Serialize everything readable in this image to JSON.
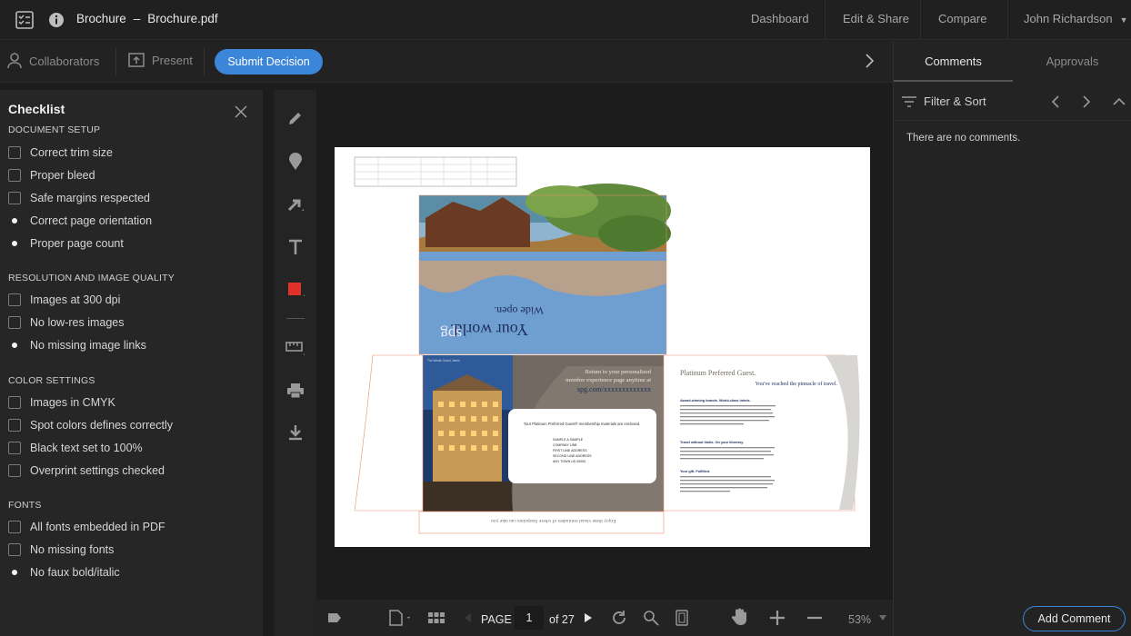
{
  "header": {
    "title": "Brochure",
    "separator": "–",
    "filename": "Brochure.pdf",
    "nav": [
      "Dashboard",
      "Edit & Share",
      "Compare"
    ],
    "user": "John Richardson"
  },
  "actionbar": {
    "collaborators": "Collaborators",
    "present": "Present",
    "submit": "Submit Decision"
  },
  "right_panel": {
    "tabs": [
      "Comments",
      "Approvals"
    ],
    "filter_label": "Filter & Sort",
    "empty_text": "There are no comments.",
    "add_comment": "Add Comment"
  },
  "checklist": {
    "title": "Checklist",
    "sections": [
      {
        "name": "DOCUMENT SETUP",
        "items": [
          {
            "label": "Correct trim size",
            "marker": "checkbox"
          },
          {
            "label": "Proper bleed",
            "marker": "checkbox"
          },
          {
            "label": "Safe margins respected",
            "marker": "checkbox"
          },
          {
            "label": "Correct page orientation",
            "marker": "dot"
          },
          {
            "label": "Proper page count",
            "marker": "dot"
          }
        ]
      },
      {
        "name": "RESOLUTION AND IMAGE QUALITY",
        "items": [
          {
            "label": "Images at 300 dpi",
            "marker": "checkbox"
          },
          {
            "label": "No low-res images",
            "marker": "checkbox"
          },
          {
            "label": "No missing image links",
            "marker": "dot"
          }
        ]
      },
      {
        "name": "COLOR SETTINGS",
        "items": [
          {
            "label": "Images in CMYK",
            "marker": "checkbox"
          },
          {
            "label": "Spot colors defines correctly",
            "marker": "checkbox"
          },
          {
            "label": "Black text set to 100%",
            "marker": "checkbox"
          },
          {
            "label": "Overprint settings checked",
            "marker": "checkbox"
          }
        ]
      },
      {
        "name": "FONTS",
        "items": [
          {
            "label": "All fonts embedded in PDF",
            "marker": "checkbox"
          },
          {
            "label": "No missing fonts",
            "marker": "checkbox"
          },
          {
            "label": "No faux bold/italic",
            "marker": "dot"
          }
        ]
      }
    ]
  },
  "tools": [
    "pencil-icon",
    "pin-icon",
    "arrow-icon",
    "text-icon",
    "color-swatch-icon",
    "ruler-icon",
    "print-icon",
    "download-icon"
  ],
  "colors": {
    "accent": "#3b86d9",
    "swatch": "#e0302a"
  },
  "bottombar": {
    "page_label": "PAGE",
    "current_page": "1",
    "of_pages": "of 27",
    "zoom": "53%"
  },
  "document": {
    "headline": "Your world.",
    "subline": "Wide open.",
    "brand": "spg",
    "return_text_1": "Return to your personalized",
    "return_text_2": "member experience page anytime at",
    "return_url": "spg.com/xxxxxxxxxxxxx",
    "card_text": "Your Platinum Preferred Guest® membership materials are enclosed.",
    "address_lines": [
      "SAMPLE A SAMPLE",
      "COMPANY LINE",
      "FIRST LINE ADDRESS",
      "SECOND LINE ADDRESS",
      "ANY TOWN US 00000"
    ],
    "panel_title": "Platinum Preferred Guest.",
    "panel_subtitle": "You've reached the pinnacle of travel.",
    "panel_heads": [
      "Award-winning brands. World-class hotels.",
      "Travel without limits. On your itinerary.",
      "Your gift. Fulfilled."
    ],
    "bottom_flipped": "Enjoy these visual reminders of where Starpoints can take you",
    "hotel_caption": "The Westin Grand, Berlin"
  }
}
